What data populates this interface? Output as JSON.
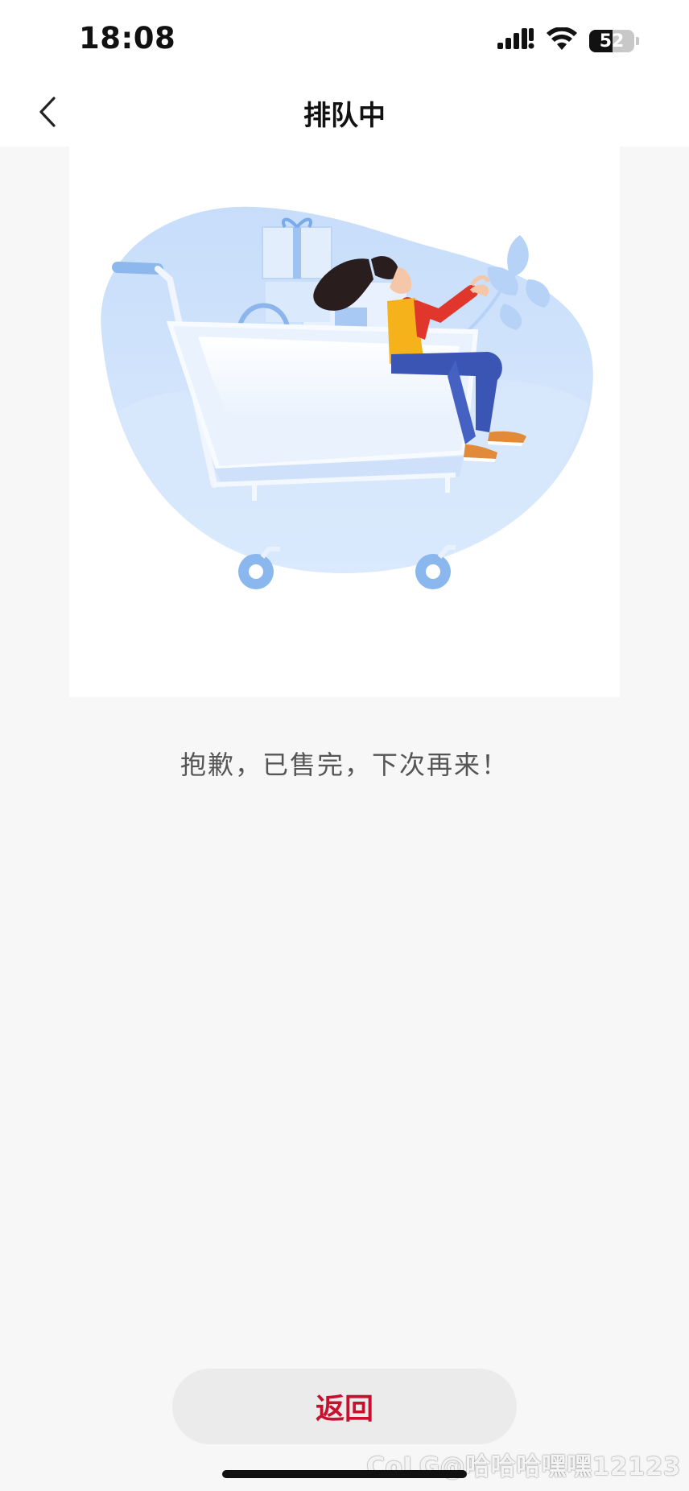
{
  "status_bar": {
    "time": "18:08",
    "battery_level": "52",
    "icons": [
      "signal-icon",
      "wifi-icon",
      "battery-icon"
    ]
  },
  "nav": {
    "title": "排队中",
    "back_icon": "chevron-left-icon"
  },
  "illustration": {
    "description_icon": "shopping-cart-illustration"
  },
  "message": "抱歉，已售完，下次再来！",
  "return_button": {
    "label": "返回"
  },
  "watermark": "CoLG@哈哈哈嘿嘿12123",
  "colors": {
    "accent": "#c8102e",
    "background": "#f7f7f7",
    "button_bg": "#ebebeb",
    "illustration_blue": "#cfe3fb"
  }
}
